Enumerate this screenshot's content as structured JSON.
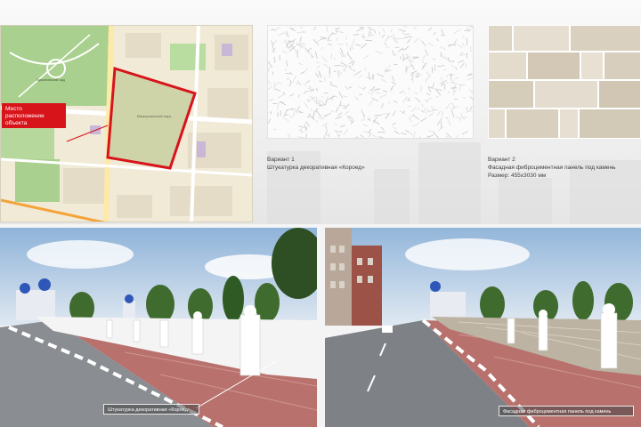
{
  "map": {
    "callout": "Место расположение объекта",
    "labels": {
      "memorial_park": "Мемориальный парк",
      "garden": "Бризлинский сад"
    }
  },
  "variant1": {
    "title": "Вариант 1",
    "description": "Штукатурка декоративная «Короед»"
  },
  "variant2": {
    "title": "Вариант 2",
    "description": "Фасадная фиброцементная панель под камень",
    "size": "Размер: 455х3030 мм"
  },
  "photo1": {
    "label": "Штукатурка декоративная «Короед»"
  },
  "photo2": {
    "label": "Фасадная фиброцементная панель под камень"
  },
  "colors": {
    "accent_red": "#d8141b",
    "map_green": "#a9d08e",
    "sky": "#b9cfe6",
    "paving": "#b8716d"
  }
}
